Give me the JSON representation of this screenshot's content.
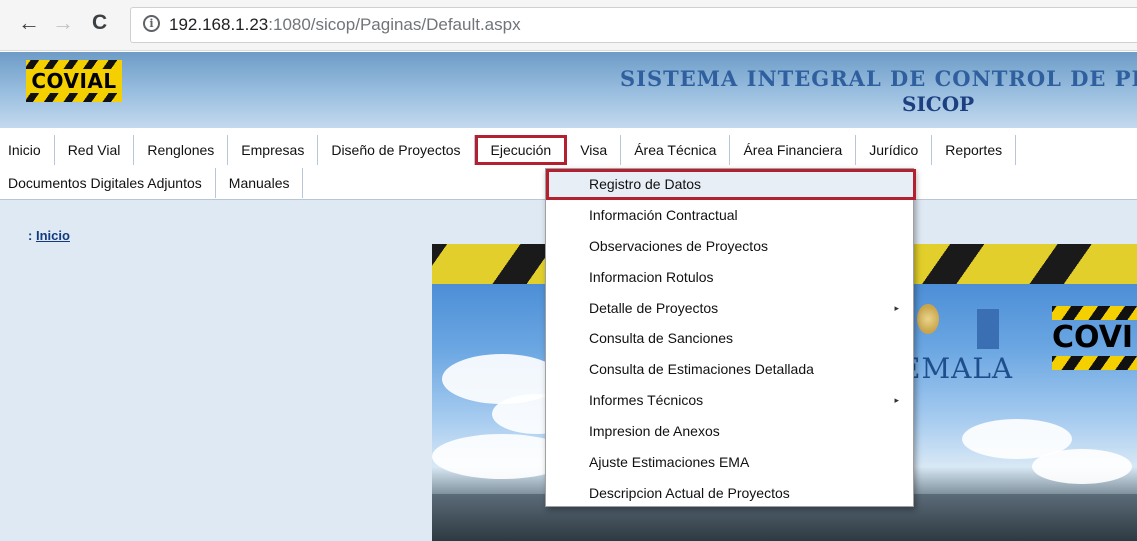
{
  "browser": {
    "back_icon": "back-arrow-icon",
    "forward_icon": "forward-arrow-icon",
    "reload_icon": "reload-icon",
    "info_icon": "info-icon",
    "url_host": "192.168.1.23",
    "url_path": ":1080/sicop/Paginas/Default.aspx"
  },
  "header": {
    "logo_text": "COVIAL",
    "system_title": "SISTEMA INTEGRAL DE CONTROL DE PR",
    "system_acronym": "SICOP"
  },
  "menu": {
    "row1": [
      "Inicio",
      "Red Vial",
      "Renglones",
      "Empresas",
      "Diseño de Proyectos",
      "Ejecución",
      "Visa",
      "Área Técnica",
      "Área Financiera",
      "Jurídico",
      "Reportes"
    ],
    "row2": [
      "Documentos Digitales Adjuntos",
      "Manuales"
    ],
    "active": "Ejecución"
  },
  "breadcrumb": {
    "prefix": ":",
    "link": "Inicio"
  },
  "hero": {
    "logo_text": "COVI",
    "country_text": "EMALA",
    "seal_caption": ""
  },
  "dropdown": {
    "items": [
      {
        "label": "Registro de Datos",
        "submenu": false,
        "highlighted": true
      },
      {
        "label": "Información Contractual",
        "submenu": false
      },
      {
        "label": "Observaciones de Proyectos",
        "submenu": false
      },
      {
        "label": "Informacion Rotulos",
        "submenu": false
      },
      {
        "label": "Detalle de Proyectos",
        "submenu": true
      },
      {
        "label": "Consulta de Sanciones",
        "submenu": false
      },
      {
        "label": "Consulta de Estimaciones Detallada",
        "submenu": false
      },
      {
        "label": "Informes Técnicos",
        "submenu": true
      },
      {
        "label": "Impresion de Anexos",
        "submenu": false
      },
      {
        "label": "Ajuste Estimaciones EMA",
        "submenu": false
      },
      {
        "label": "Descripcion Actual de Proyectos",
        "submenu": false
      }
    ],
    "submenu_arrow": "▸"
  },
  "colors": {
    "highlight_border": "#b3202f",
    "banner_blue": "#6d9cc7",
    "content_bg": "#dfe9f4"
  }
}
